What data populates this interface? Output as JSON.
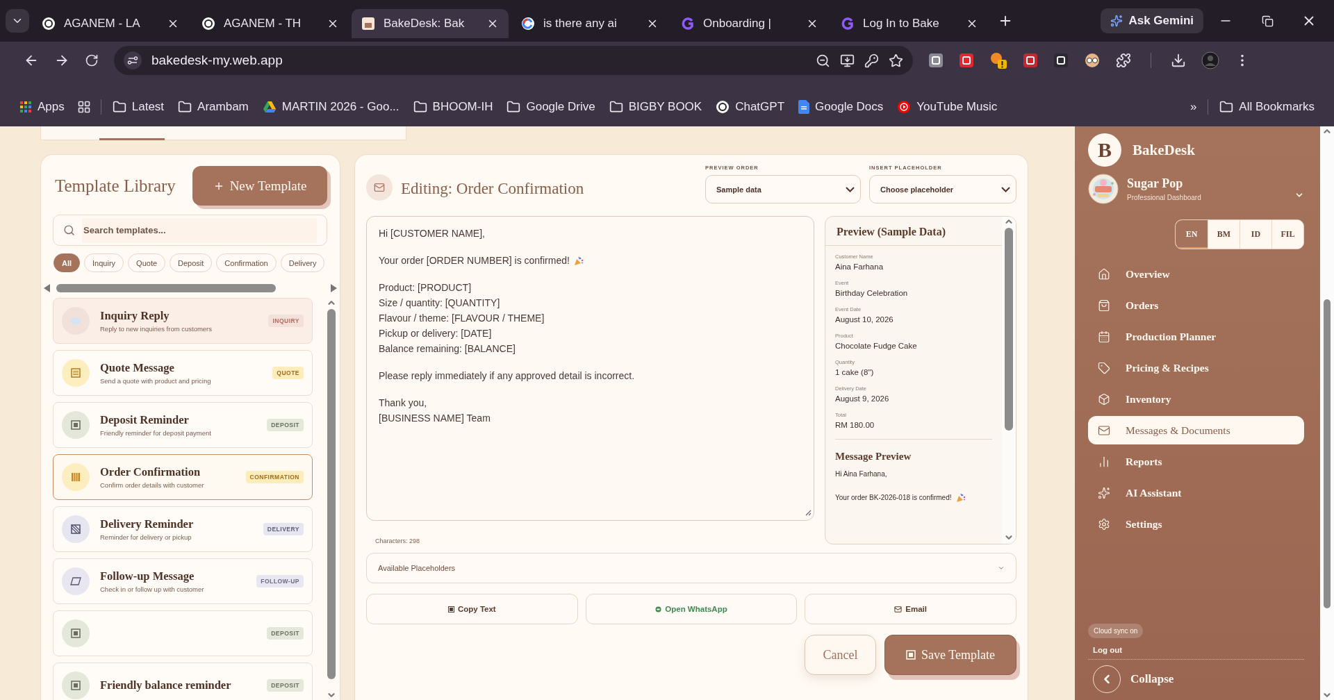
{
  "browser": {
    "tabs": [
      {
        "title": "AGANEM - LA",
        "kind": "chatgpt",
        "selected": false
      },
      {
        "title": "AGANEM - TH",
        "kind": "chatgpt",
        "selected": false
      },
      {
        "title": "BakeDesk: Bak",
        "kind": "bakedesk",
        "selected": true
      },
      {
        "title": "is there any ai",
        "kind": "google",
        "selected": false
      },
      {
        "title": "Onboarding |",
        "kind": "letter-g",
        "selected": false
      },
      {
        "title": "Log In to Bake",
        "kind": "letter-g",
        "selected": false
      }
    ],
    "gemini_button": "Ask Gemini",
    "address": "bakedesk-my.web.app",
    "bookmarks": [
      {
        "label": "Apps",
        "kind": "apps"
      },
      {
        "label": "Latest",
        "kind": "folder"
      },
      {
        "label": "Arambam",
        "kind": "folder"
      },
      {
        "label": "MARTIN 2026 - Goo...",
        "kind": "drive"
      },
      {
        "label": "BHOOM-IH",
        "kind": "folder"
      },
      {
        "label": "Google Drive",
        "kind": "folder"
      },
      {
        "label": "BIGBY BOOK",
        "kind": "folder"
      },
      {
        "label": "ChatGPT",
        "kind": "chatgpt"
      },
      {
        "label": "Google Docs",
        "kind": "docs"
      },
      {
        "label": "YouTube Music",
        "kind": "music"
      }
    ],
    "more_bookmarks": "»",
    "all_bookmarks": "All Bookmarks"
  },
  "library": {
    "title": "Template Library",
    "new_button": "New Template",
    "search": {
      "placeholder": "Search templates..."
    },
    "filters": [
      {
        "label": "All",
        "selected": true
      },
      {
        "label": "Inquiry",
        "selected": false
      },
      {
        "label": "Quote",
        "selected": false
      },
      {
        "label": "Deposit",
        "selected": false
      },
      {
        "label": "Confirmation",
        "selected": false
      },
      {
        "label": "Delivery",
        "selected": false
      }
    ],
    "templates": [
      {
        "title": "Inquiry Reply",
        "description": "Reply to new inquiries from customers",
        "tag": "INQUIRY",
        "kind": "inquiry",
        "selected": false,
        "hovered": true
      },
      {
        "title": "Quote Message",
        "description": "Send a quote with product and pricing",
        "tag": "QUOTE",
        "kind": "quote",
        "selected": false,
        "hovered": false
      },
      {
        "title": "Deposit Reminder",
        "description": "Friendly reminder for deposit payment",
        "tag": "DEPOSIT",
        "kind": "deposit",
        "selected": false,
        "hovered": false
      },
      {
        "title": "Order Confirmation",
        "description": "Confirm order details with customer",
        "tag": "CONFIRMATION",
        "kind": "confirmation",
        "selected": true,
        "hovered": false
      },
      {
        "title": "Delivery Reminder",
        "description": "Reminder for delivery or pickup",
        "tag": "DELIVERY",
        "kind": "delivery",
        "selected": false,
        "hovered": false
      },
      {
        "title": "Follow-up Message",
        "description": "Check in or follow up with customer",
        "tag": "FOLLOW-UP",
        "kind": "followup",
        "selected": false,
        "hovered": false
      },
      {
        "tag": "DEPOSIT",
        "kind": "deposit",
        "selected": false,
        "hovered": false
      },
      {
        "title": "Friendly balance reminder",
        "tag": "DEPOSIT",
        "kind": "deposit",
        "selected": false,
        "hovered": false
      }
    ]
  },
  "editor": {
    "title": "Editing: Order Confirmation",
    "preview_order": {
      "label": "PREVIEW ORDER",
      "value": "Sample data"
    },
    "insert_placeholder": {
      "label": "INSERT PLACEHOLDER",
      "value": "Choose placeholder"
    },
    "body": [
      [
        {
          "text": "Hi [CUSTOMER NAME],",
          "kind": "plain"
        }
      ],
      [
        {
          "text": "Your order [ORDER NUMBER] is confirmed!",
          "kind": "party"
        }
      ],
      [
        {
          "text": "Product: [PRODUCT]",
          "kind": "plain"
        },
        {
          "text": "Size / quantity: [QUANTITY]",
          "kind": "plain"
        },
        {
          "text": "Flavour / theme: [FLAVOUR / THEME]",
          "kind": "plain"
        },
        {
          "text": "Pickup or delivery: [DATE]",
          "kind": "plain"
        },
        {
          "text": "Balance remaining: [BALANCE]",
          "kind": "plain"
        }
      ],
      [
        {
          "text": "Please reply immediately if any approved detail is incorrect.",
          "kind": "plain"
        }
      ],
      [
        {
          "text": "Thank you,",
          "kind": "plain"
        },
        {
          "text": "[BUSINESS NAME] Team",
          "kind": "plain"
        }
      ]
    ],
    "characters": "Characters: 298",
    "preview": {
      "title": "Preview (Sample Data)",
      "fields": [
        {
          "label": "Customer Name",
          "value": "Aina Farhana"
        },
        {
          "label": "Event",
          "value": "Birthday Celebration"
        },
        {
          "label": "Event Date",
          "value": "August 10, 2026"
        },
        {
          "label": "Product",
          "value": "Chocolate Fudge Cake"
        },
        {
          "label": "Quantity",
          "value": "1 cake (8\")"
        },
        {
          "label": "Delivery Date",
          "value": "August 9, 2026"
        },
        {
          "label": "Total",
          "value": "RM 180.00"
        }
      ],
      "message_title": "Message Preview",
      "message": [
        {
          "text": "Hi Aina Farhana,",
          "kind": "plain"
        },
        {
          "text": "Your order BK-2026-018 is confirmed!",
          "kind": "party"
        }
      ]
    },
    "placeholders": {
      "label": "Available Placeholders",
      "expanded": false
    },
    "actions": [
      {
        "label": "Copy Text",
        "kind": "copy"
      },
      {
        "label": "Open WhatsApp",
        "kind": "whatsapp"
      },
      {
        "label": "Email",
        "kind": "email"
      }
    ],
    "cancel": "Cancel",
    "save": "Save Template"
  },
  "sidebar": {
    "logo_letter": "B",
    "brand": "BakeDesk",
    "business": "Sugar Pop",
    "subtitle": "Professional Dashboard",
    "languages": [
      {
        "label": "EN",
        "selected": true
      },
      {
        "label": "BM",
        "selected": false
      },
      {
        "label": "ID",
        "selected": false
      },
      {
        "label": "FIL",
        "selected": false
      }
    ],
    "nav": [
      {
        "label": "Overview",
        "kind": "home",
        "selected": false
      },
      {
        "label": "Orders",
        "kind": "bag",
        "selected": false
      },
      {
        "label": "Production Planner",
        "kind": "calendar",
        "selected": false
      },
      {
        "label": "Pricing & Recipes",
        "kind": "tag",
        "selected": false
      },
      {
        "label": "Inventory",
        "kind": "box",
        "selected": false
      },
      {
        "label": "Messages & Documents",
        "kind": "mail",
        "selected": true
      },
      {
        "label": "Reports",
        "kind": "chart",
        "selected": false
      },
      {
        "label": "AI Assistant",
        "kind": "sparkles",
        "selected": false
      },
      {
        "label": "Settings",
        "kind": "settings",
        "selected": false
      }
    ],
    "sync_badge": "Cloud sync on",
    "logout": "Log out",
    "collapse": "Collapse"
  }
}
